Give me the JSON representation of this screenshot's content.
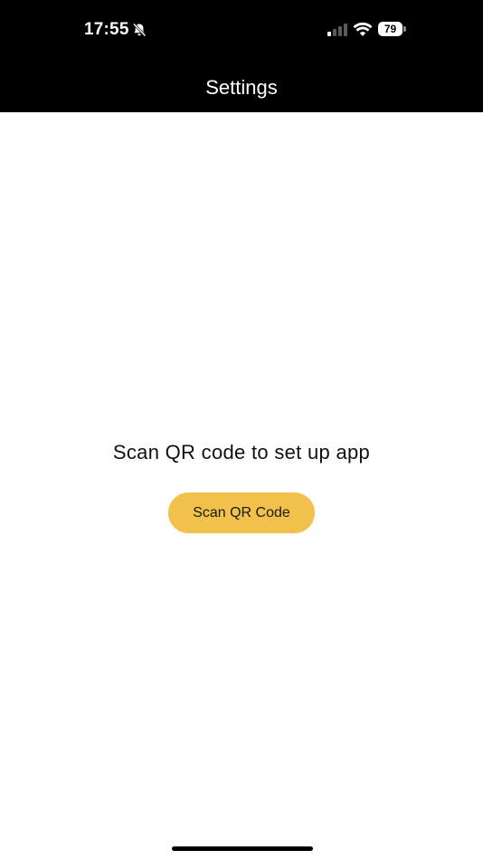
{
  "status_bar": {
    "time": "17:55",
    "battery_level": "79",
    "silent_icon": "bell-slash-icon",
    "signal_icon": "cellular-signal-icon",
    "wifi_icon": "wifi-icon"
  },
  "header": {
    "title": "Settings"
  },
  "main": {
    "instruction": "Scan QR code to set up app",
    "scan_button_label": "Scan QR Code"
  },
  "colors": {
    "header_bg": "#000000",
    "button_bg": "#f1c14b",
    "page_bg": "#ffffff"
  }
}
